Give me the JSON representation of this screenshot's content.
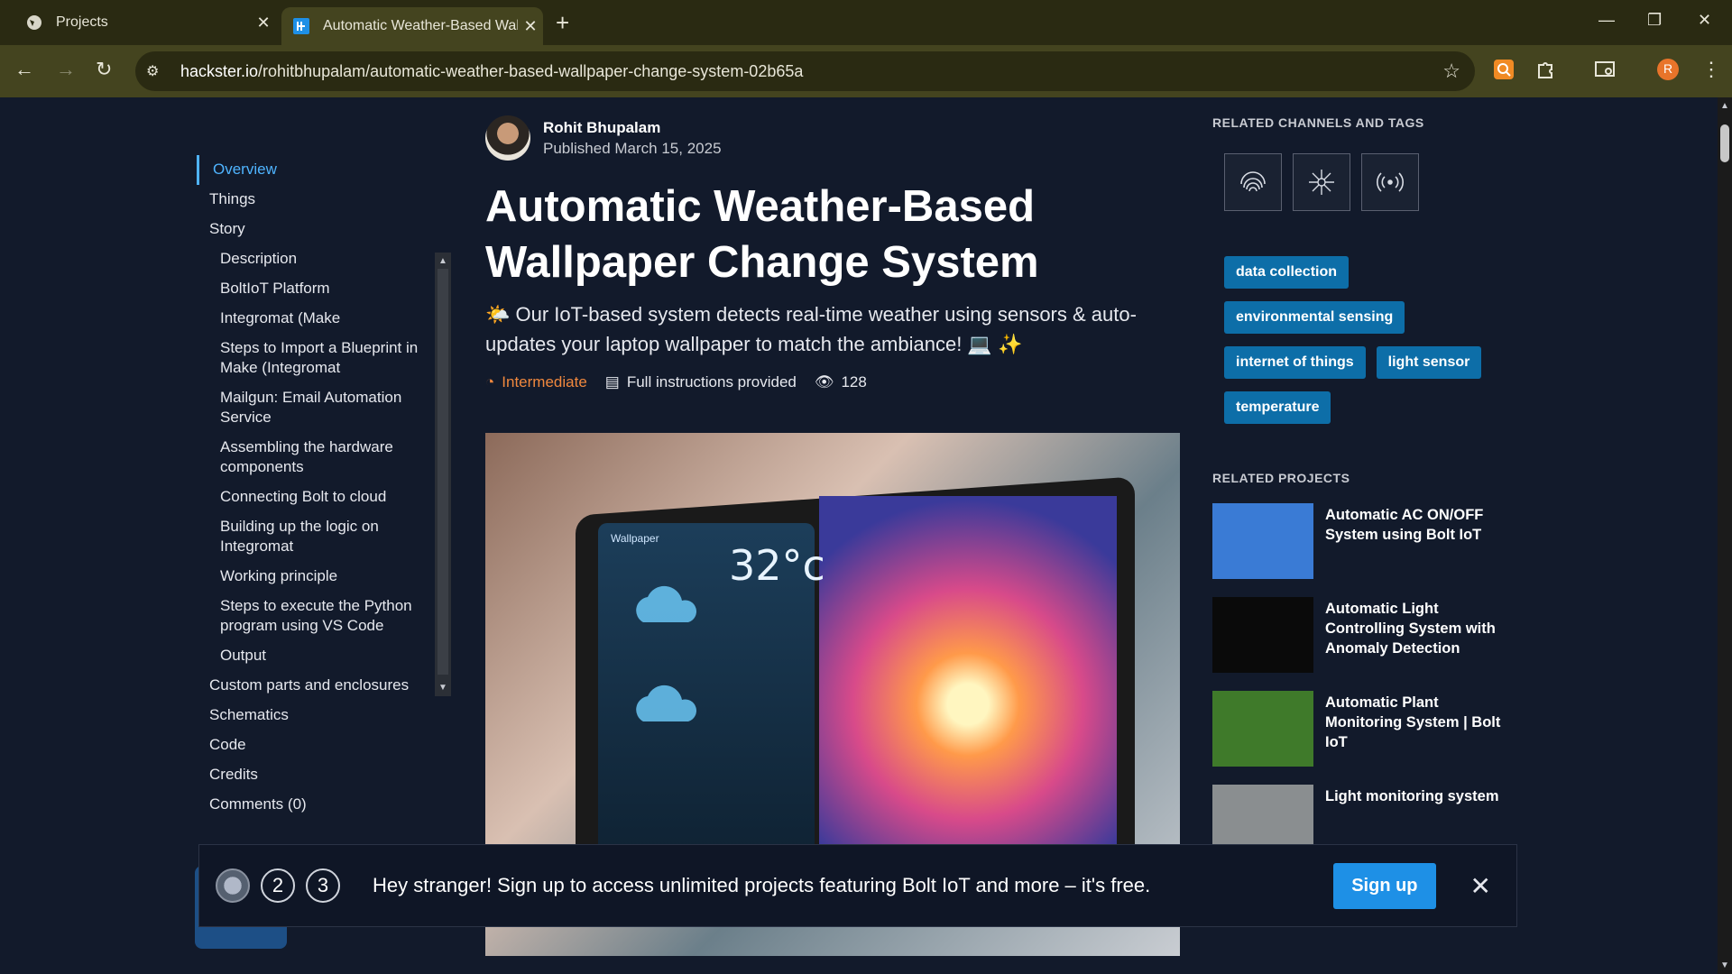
{
  "browser": {
    "tabs": [
      {
        "title": "Projects",
        "active": false
      },
      {
        "title": "Automatic Weather-Based Wall",
        "active": true
      }
    ],
    "url_host": "hackster.io",
    "url_path": "/rohitbhupalam/automatic-weather-based-wallpaper-change-system-02b65a",
    "profile_initial": "R"
  },
  "toc": {
    "items": [
      {
        "label": "Overview",
        "level": 0,
        "active": true
      },
      {
        "label": "Things",
        "level": 0
      },
      {
        "label": "Story",
        "level": 0
      },
      {
        "label": "Description",
        "level": 1
      },
      {
        "label": "BoltIoT Platform",
        "level": 1
      },
      {
        "label": "Integromat (Make",
        "level": 1
      },
      {
        "label": "Steps to Import a Blueprint in Make (Integromat",
        "level": 1
      },
      {
        "label": "Mailgun: Email Automation Service",
        "level": 1
      },
      {
        "label": "Assembling the hardware components",
        "level": 1
      },
      {
        "label": "Connecting Bolt to cloud",
        "level": 1
      },
      {
        "label": "Building up the logic on Integromat",
        "level": 1
      },
      {
        "label": "Working principle",
        "level": 1
      },
      {
        "label": "Steps to execute the Python program using VS Code",
        "level": 1
      },
      {
        "label": "Output",
        "level": 1
      },
      {
        "label": "Custom parts and enclosures",
        "level": 0
      },
      {
        "label": "Schematics",
        "level": 0
      },
      {
        "label": "Code",
        "level": 0
      },
      {
        "label": "Credits",
        "level": 0
      },
      {
        "label": "Comments (0)",
        "level": 0
      }
    ]
  },
  "article": {
    "author_name": "Rohit Bhupalam",
    "published": "Published March 15, 2025",
    "title": "Automatic Weather-Based Wallpaper Change System",
    "subtitle": "🌤️ Our IoT-based system detects real-time weather using sensors & auto-updates your laptop wallpaper to match the ambiance! 💻 ✨",
    "difficulty": "Intermediate",
    "instructions": "Full instructions provided",
    "views": "128",
    "hero_temp": "32°c",
    "hero_label": "Wallpaper"
  },
  "sidebar": {
    "channels_heading": "RELATED CHANNELS AND TAGS",
    "channel_icons": [
      "fingerprint-icon",
      "network-icon",
      "wireless-signal-icon"
    ],
    "tags": [
      "data collection",
      "environmental sensing",
      "internet of things",
      "light sensor",
      "temperature"
    ],
    "projects_heading": "RELATED PROJECTS",
    "projects": [
      {
        "name": "Automatic AC ON/OFF System using Bolt IoT",
        "thumb_color": "#3a7bd5"
      },
      {
        "name": "Automatic Light Controlling System with Anomaly Detection",
        "thumb_color": "#0a0a0a"
      },
      {
        "name": "Automatic Plant Monitoring System | Bolt IoT",
        "thumb_color": "#3f7a2a"
      },
      {
        "name": "Light monitoring system",
        "thumb_color": "#8a8e90"
      }
    ]
  },
  "banner": {
    "bubble_2": "2",
    "bubble_3": "3",
    "text": "Hey stranger! Sign up to access unlimited projects featuring Bolt IoT and more – it's free.",
    "signup_label": "Sign up"
  },
  "colors": {
    "accent": "#4fb4ff",
    "tag_bg": "#0d6ea8",
    "difficulty": "#f0883e",
    "signup": "#1e90e6"
  }
}
